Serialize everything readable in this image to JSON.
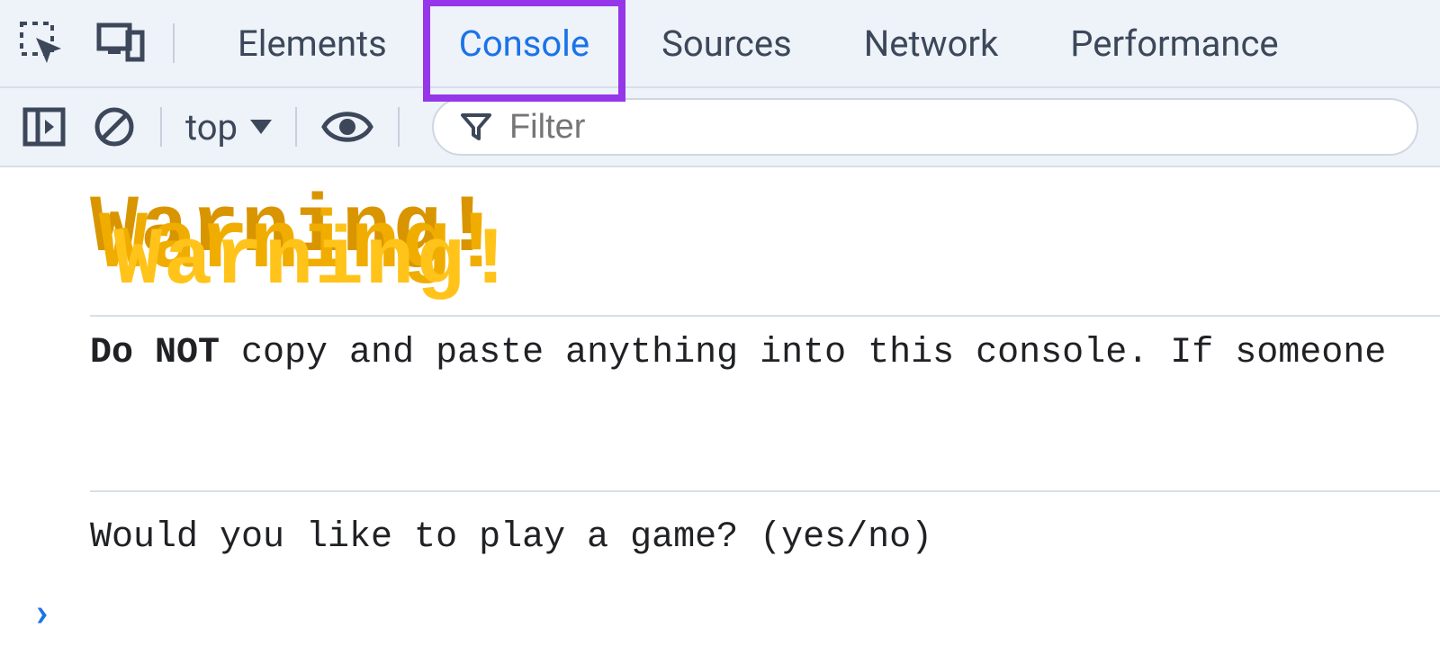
{
  "tabs": {
    "elements": "Elements",
    "console": "Console",
    "sources": "Sources",
    "network": "Network",
    "performance": "Performance"
  },
  "active_tab": "console",
  "toolbar": {
    "context": "top",
    "filter_placeholder": "Filter"
  },
  "console": {
    "warning_text": "Warning!",
    "do_not_bold": "Do NOT",
    "do_not_rest": " copy and paste anything into this console.  If someone ",
    "game_prompt": "Would you like to play a game? (yes/no)",
    "input_prompt_symbol": "›"
  },
  "colors": {
    "tab_active_border": "#9536e8",
    "tab_active_text": "#1a73e8",
    "panel_bg": "#eef2f9"
  }
}
